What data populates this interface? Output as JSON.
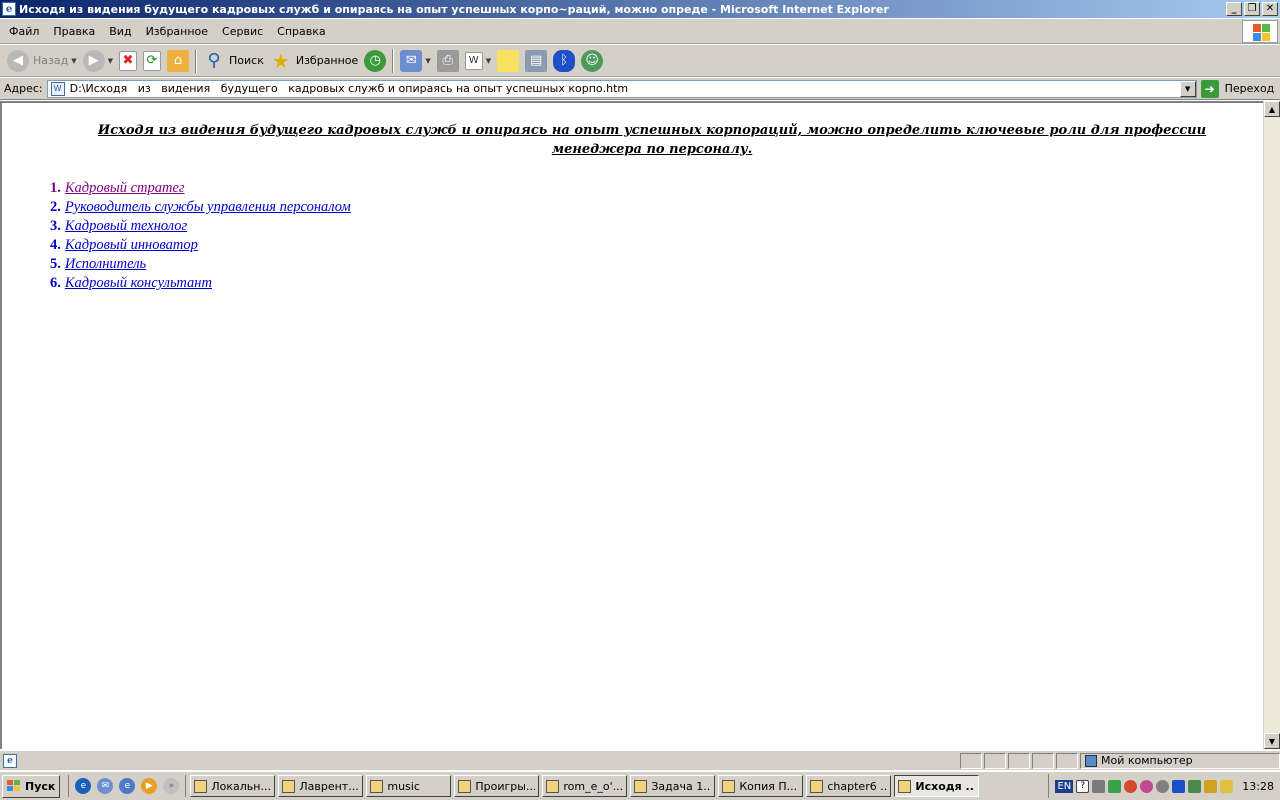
{
  "window": {
    "title": "Исходя из видения будущего кадровых служб и опираясь на опыт успешных корпо~раций, можно опреде - Microsoft Internet Explorer",
    "min_label": "_",
    "restore_label": "❐",
    "close_label": "✕"
  },
  "menu": {
    "items": [
      "Файл",
      "Правка",
      "Вид",
      "Избранное",
      "Сервис",
      "Справка"
    ]
  },
  "toolbar": {
    "back_label": "Назад",
    "search_label": "Поиск",
    "favorites_label": "Избранное"
  },
  "address": {
    "label": "Адрес:",
    "value": "D:\\Исходя   из   видения   будущего   кадровых служб и опираясь на опыт успешных корпо.htm",
    "go_label": "Переход"
  },
  "page": {
    "heading": "Исходя   из   видения   будущего   кадровых служб и опираясь на опыт успешных корпораций, можно определить  ключевые  роли для профессии менеджера по персоналу.",
    "roles": [
      {
        "num": "1.",
        "label": "Кадровый стратег",
        "visited": true
      },
      {
        "num": "2.",
        "label": "Руководитель службы управления персоналом",
        "visited": false
      },
      {
        "num": "3.",
        "label": "Кадровый технолог",
        "visited": false
      },
      {
        "num": "4.",
        "label": "Кадровый инноватор",
        "visited": false
      },
      {
        "num": "5.",
        "label": "Исполнитель",
        "visited": false
      },
      {
        "num": "6.",
        "label": "Кадровый консультант",
        "visited": false
      }
    ],
    "colors": {
      "link": "#0000cc",
      "visited": "#800080"
    }
  },
  "statusbar": {
    "zone": "Мой компьютер"
  },
  "taskbar": {
    "start_label": "Пуск",
    "tasks": [
      {
        "label": "Локальн...",
        "active": false
      },
      {
        "label": "Лаврент...",
        "active": false
      },
      {
        "label": "music",
        "active": false
      },
      {
        "label": "Проигры...",
        "active": false
      },
      {
        "label": "rom_e_o'...",
        "active": false
      },
      {
        "label": "Задача 1...",
        "active": false
      },
      {
        "label": "Копия П...",
        "active": false
      },
      {
        "label": "chapter6 ...",
        "active": false
      },
      {
        "label": "Исходя ...",
        "active": true
      }
    ],
    "lang": "EN",
    "clock": "13:28"
  }
}
